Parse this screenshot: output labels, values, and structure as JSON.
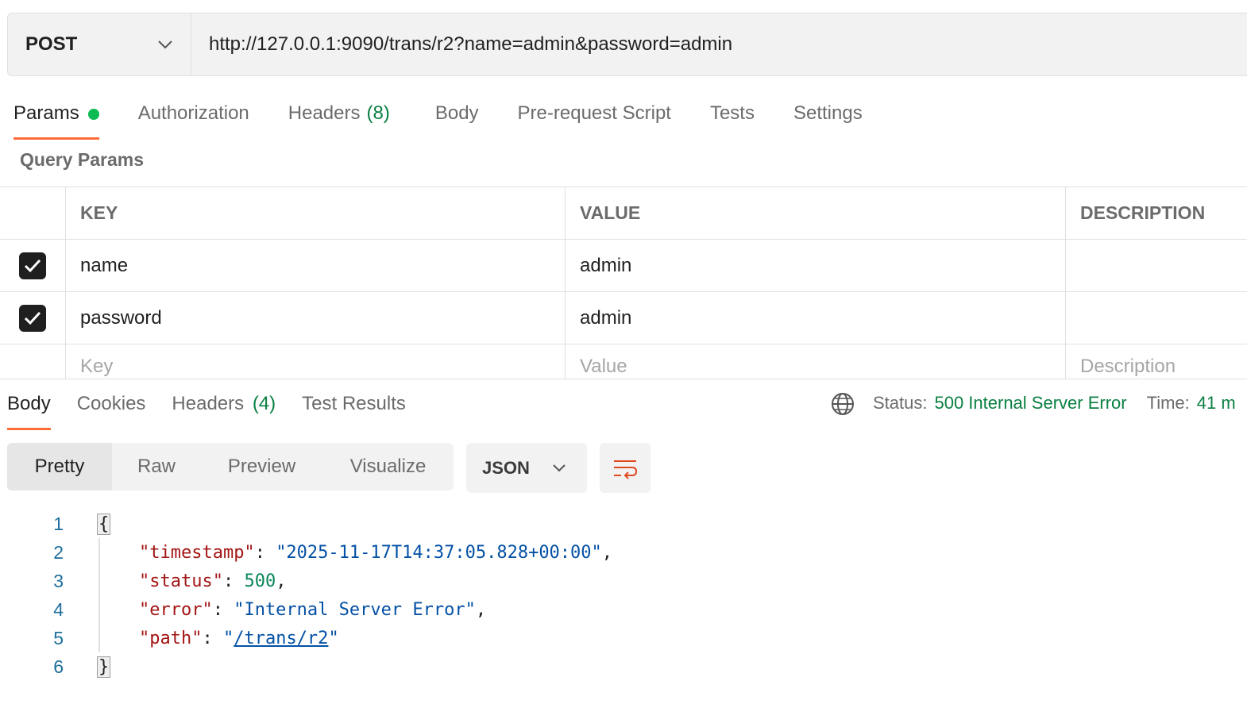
{
  "request": {
    "method": "POST",
    "url": "http://127.0.0.1:9090/trans/r2?name=admin&password=admin"
  },
  "request_tabs": [
    {
      "label": "Params",
      "active": true,
      "indicator": "green-dot"
    },
    {
      "label": "Authorization"
    },
    {
      "label": "Headers",
      "count": "(8)"
    },
    {
      "label": "Body"
    },
    {
      "label": "Pre-request Script"
    },
    {
      "label": "Tests"
    },
    {
      "label": "Settings"
    }
  ],
  "query_params": {
    "title": "Query Params",
    "columns": [
      "KEY",
      "VALUE",
      "DESCRIPTION"
    ],
    "rows": [
      {
        "checked": true,
        "key": "name",
        "value": "admin",
        "description": ""
      },
      {
        "checked": true,
        "key": "password",
        "value": "admin",
        "description": ""
      }
    ],
    "placeholders": {
      "key": "Key",
      "value": "Value",
      "description": "Description"
    }
  },
  "response_tabs": [
    {
      "label": "Body",
      "active": true
    },
    {
      "label": "Cookies"
    },
    {
      "label": "Headers",
      "count": "(4)"
    },
    {
      "label": "Test Results"
    }
  ],
  "response_status": {
    "status_label": "Status:",
    "status_value": "500 Internal Server Error",
    "time_label": "Time:",
    "time_value": "41 m"
  },
  "view_modes": [
    "Pretty",
    "Raw",
    "Preview",
    "Visualize"
  ],
  "active_view": "Pretty",
  "format": "JSON",
  "response_body": {
    "line_numbers": [
      "1",
      "2",
      "3",
      "4",
      "5",
      "6"
    ],
    "open_brace": "{",
    "close_brace": "}",
    "fields": [
      {
        "key": "\"timestamp\"",
        "value": "\"2025-11-17T14:37:05.828+00:00\"",
        "type": "string"
      },
      {
        "key": "\"status\"",
        "value": "500",
        "type": "number"
      },
      {
        "key": "\"error\"",
        "value": "\"Internal Server Error\"",
        "type": "string"
      },
      {
        "key": "\"path\"",
        "value": "/trans/r2",
        "type": "link"
      }
    ]
  },
  "colors": {
    "accent": "#ff6c37",
    "success_green": "#0b8043",
    "dot_green": "#0cbb52",
    "json_key": "#a31515",
    "json_string": "#0451a5",
    "json_number": "#098658"
  },
  "icons": {
    "method_dropdown": "chevron-down-icon",
    "globe": "globe-icon",
    "format_dropdown": "chevron-down-icon",
    "wrap": "wrap-lines-icon",
    "checkbox": "checkmark-icon"
  }
}
